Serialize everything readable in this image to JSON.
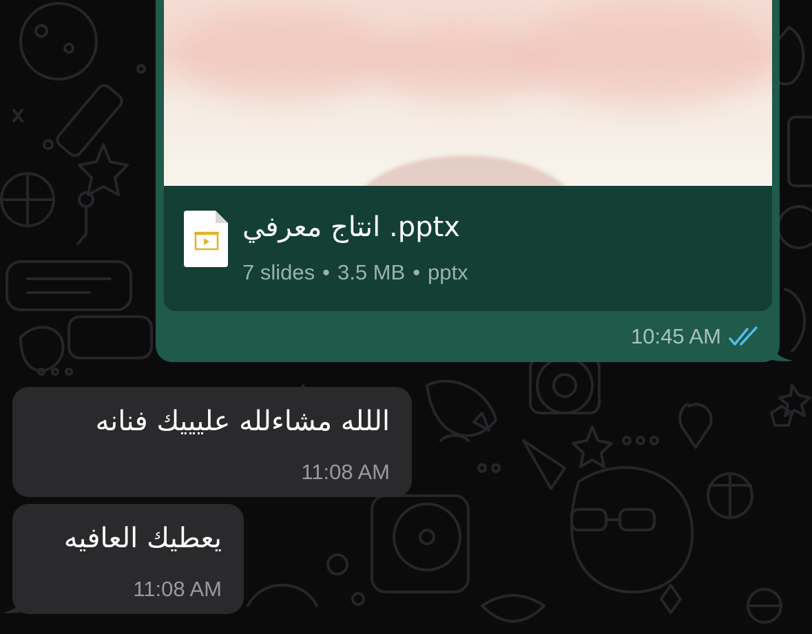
{
  "chat": {
    "outgoing_document": {
      "file_name": "انتاج معرفي .pptx",
      "slides": "7 slides",
      "size": "3.5 MB",
      "file_type": "pptx",
      "separator": "•",
      "time": "10:45 AM",
      "status_icon": "double-check-read-icon",
      "file_icon": "presentation-file-icon"
    },
    "incoming_messages": [
      {
        "text": "اللله مشاءلله عليييك فنانه",
        "time": "11:08 AM"
      },
      {
        "text": "يعطيك العافيه",
        "time": "11:08 AM"
      }
    ]
  },
  "colors": {
    "background": "#0b0b0c",
    "outgoing_bubble": "#1f5a4b",
    "document_card": "#143f35",
    "incoming_bubble": "#2a2a2c",
    "read_ticks": "#53bdeb"
  }
}
